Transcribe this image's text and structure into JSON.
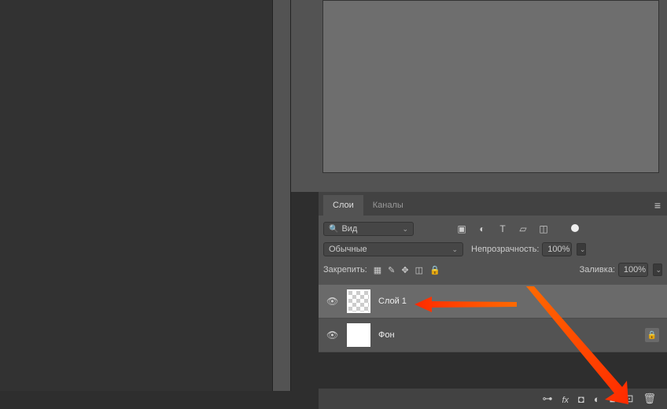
{
  "tabs": {
    "layers": "Слои",
    "channels": "Каналы"
  },
  "search": {
    "label": "Вид"
  },
  "blend_mode": {
    "value": "Обычные"
  },
  "opacity": {
    "label": "Непрозрачность:",
    "value": "100%"
  },
  "lock": {
    "label": "Закрепить:"
  },
  "fill": {
    "label": "Заливка:",
    "value": "100%"
  },
  "layers": [
    {
      "name": "Слой 1",
      "selected": true,
      "transparent": true,
      "locked": false
    },
    {
      "name": "Фон",
      "selected": false,
      "transparent": false,
      "locked": true
    }
  ],
  "filter_icons": [
    "image-icon",
    "circle-icon",
    "type-icon",
    "crop-icon",
    "artboard-icon"
  ],
  "bottom_icons": [
    "link-icon",
    "fx-icon",
    "mask-icon",
    "adjustment-icon",
    "group-icon",
    "new-layer-icon",
    "trash-icon"
  ]
}
